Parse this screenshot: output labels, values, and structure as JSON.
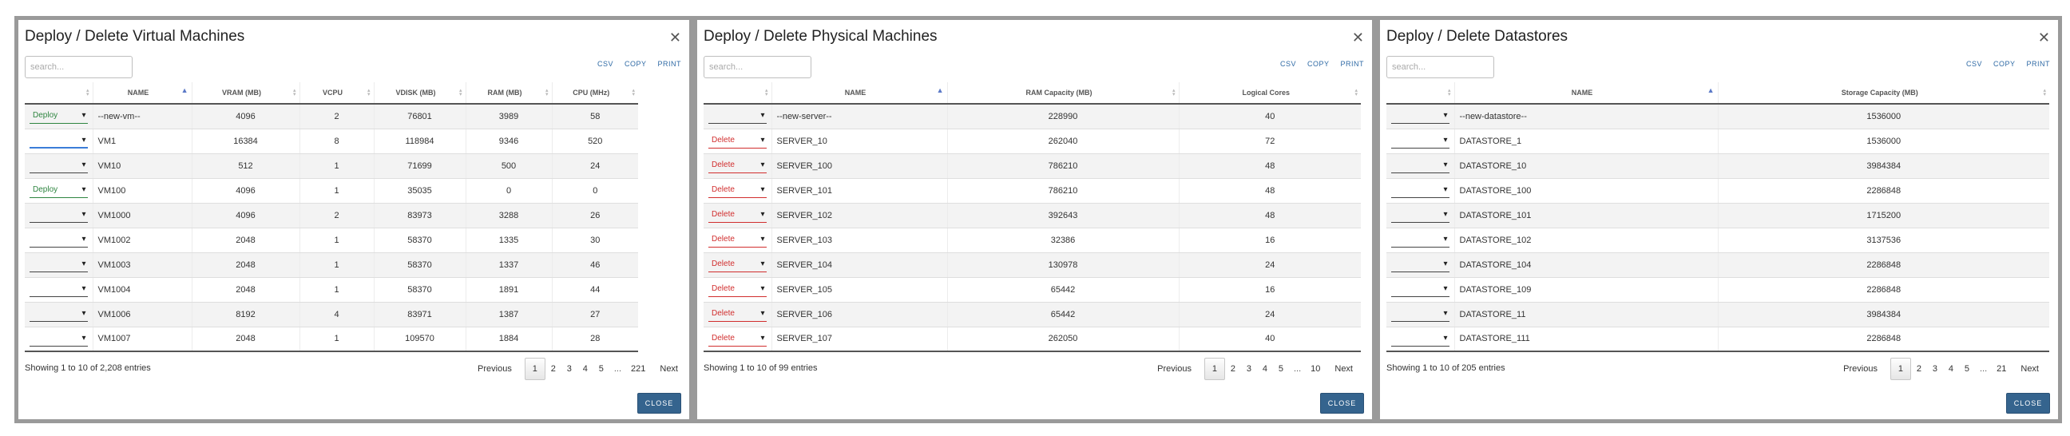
{
  "vm": {
    "title": "Deploy / Delete Virtual Machines",
    "search_placeholder": "search...",
    "exports": [
      "CSV",
      "COPY",
      "PRINT"
    ],
    "columns": [
      "",
      "NAME",
      "VRAM (MB)",
      "VCPU",
      "VDISK (MB)",
      "RAM (MB)",
      "CPU (MHz)"
    ],
    "sorted_column": "NAME",
    "rows": [
      {
        "action": "Deploy",
        "cells": [
          "--new-vm--",
          "4096",
          "2",
          "76801",
          "3989",
          "58"
        ]
      },
      {
        "action": "",
        "cells": [
          "VM1",
          "16384",
          "8",
          "118984",
          "9346",
          "520"
        ]
      },
      {
        "action": "",
        "cells": [
          "VM10",
          "512",
          "1",
          "71699",
          "500",
          "24"
        ]
      },
      {
        "action": "Deploy",
        "cells": [
          "VM100",
          "4096",
          "1",
          "35035",
          "0",
          "0"
        ]
      },
      {
        "action": "",
        "cells": [
          "VM1000",
          "4096",
          "2",
          "83973",
          "3288",
          "26"
        ]
      },
      {
        "action": "",
        "cells": [
          "VM1002",
          "2048",
          "1",
          "58370",
          "1335",
          "30"
        ]
      },
      {
        "action": "",
        "cells": [
          "VM1003",
          "2048",
          "1",
          "58370",
          "1337",
          "46"
        ]
      },
      {
        "action": "",
        "cells": [
          "VM1004",
          "2048",
          "1",
          "58370",
          "1891",
          "44"
        ]
      },
      {
        "action": "",
        "cells": [
          "VM1006",
          "8192",
          "4",
          "83971",
          "1387",
          "27"
        ]
      },
      {
        "action": "",
        "cells": [
          "VM1007",
          "2048",
          "1",
          "109570",
          "1884",
          "28"
        ]
      }
    ],
    "info": "Showing 1 to 10 of 2,208 entries",
    "pager": {
      "previous": "Previous",
      "pages": [
        "1",
        "2",
        "3",
        "4",
        "5",
        "...",
        "221"
      ],
      "next": "Next",
      "current": "1"
    },
    "close": "CLOSE"
  },
  "pm": {
    "title": "Deploy / Delete Physical Machines",
    "search_placeholder": "search...",
    "exports": [
      "CSV",
      "COPY",
      "PRINT"
    ],
    "columns": [
      "",
      "NAME",
      "RAM Capacity (MB)",
      "Logical Cores"
    ],
    "sorted_column": "NAME",
    "rows": [
      {
        "action": "",
        "cells": [
          "--new-server--",
          "228990",
          "40"
        ]
      },
      {
        "action": "Delete",
        "cells": [
          "SERVER_10",
          "262040",
          "72"
        ]
      },
      {
        "action": "Delete",
        "cells": [
          "SERVER_100",
          "786210",
          "48"
        ]
      },
      {
        "action": "Delete",
        "cells": [
          "SERVER_101",
          "786210",
          "48"
        ]
      },
      {
        "action": "Delete",
        "cells": [
          "SERVER_102",
          "392643",
          "48"
        ]
      },
      {
        "action": "Delete",
        "cells": [
          "SERVER_103",
          "32386",
          "16"
        ]
      },
      {
        "action": "Delete",
        "cells": [
          "SERVER_104",
          "130978",
          "24"
        ]
      },
      {
        "action": "Delete",
        "cells": [
          "SERVER_105",
          "65442",
          "16"
        ]
      },
      {
        "action": "Delete",
        "cells": [
          "SERVER_106",
          "65442",
          "24"
        ]
      },
      {
        "action": "Delete",
        "cells": [
          "SERVER_107",
          "262050",
          "40"
        ]
      }
    ],
    "info": "Showing 1 to 10 of 99 entries",
    "pager": {
      "previous": "Previous",
      "pages": [
        "1",
        "2",
        "3",
        "4",
        "5",
        "...",
        "10"
      ],
      "next": "Next",
      "current": "1"
    },
    "close": "CLOSE"
  },
  "ds": {
    "title": "Deploy / Delete Datastores",
    "search_placeholder": "search...",
    "exports": [
      "CSV",
      "COPY",
      "PRINT"
    ],
    "columns": [
      "",
      "NAME",
      "Storage Capacity (MB)"
    ],
    "sorted_column": "NAME",
    "rows": [
      {
        "action": "",
        "cells": [
          "--new-datastore--",
          "1536000"
        ]
      },
      {
        "action": "",
        "cells": [
          "DATASTORE_1",
          "1536000"
        ]
      },
      {
        "action": "",
        "cells": [
          "DATASTORE_10",
          "3984384"
        ]
      },
      {
        "action": "",
        "cells": [
          "DATASTORE_100",
          "2286848"
        ]
      },
      {
        "action": "",
        "cells": [
          "DATASTORE_101",
          "1715200"
        ]
      },
      {
        "action": "",
        "cells": [
          "DATASTORE_102",
          "3137536"
        ]
      },
      {
        "action": "",
        "cells": [
          "DATASTORE_104",
          "2286848"
        ]
      },
      {
        "action": "",
        "cells": [
          "DATASTORE_109",
          "2286848"
        ]
      },
      {
        "action": "",
        "cells": [
          "DATASTORE_11",
          "3984384"
        ]
      },
      {
        "action": "",
        "cells": [
          "DATASTORE_111",
          "2286848"
        ]
      }
    ],
    "info": "Showing 1 to 10 of 205 entries",
    "pager": {
      "previous": "Previous",
      "pages": [
        "1",
        "2",
        "3",
        "4",
        "5",
        "...",
        "21"
      ],
      "next": "Next",
      "current": "1"
    },
    "close": "CLOSE"
  },
  "colors": {
    "accent": "#35648e",
    "deploy": "#2e8540",
    "delete": "#d12e2e",
    "link": "#2f6aa5",
    "sort_active": "#5b79c7"
  },
  "icons": {
    "close": "close-icon",
    "dropdown": "chevron-down-icon",
    "sort": "sort-icon"
  }
}
